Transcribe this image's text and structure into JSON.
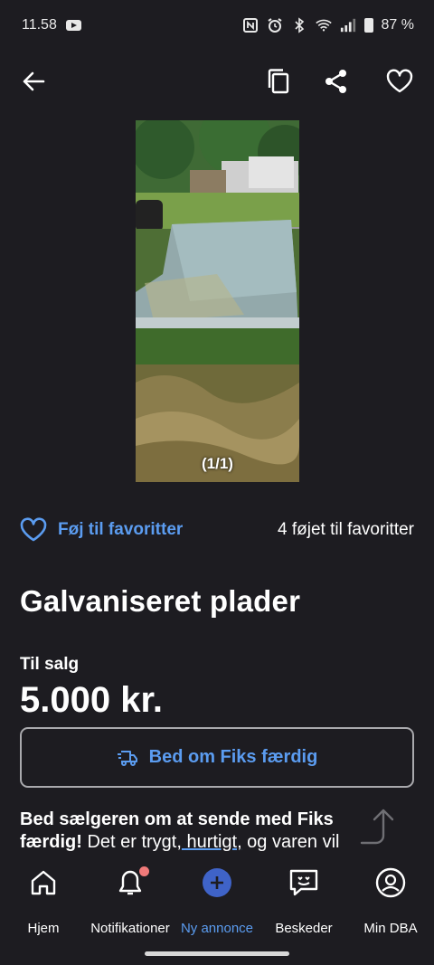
{
  "status_bar": {
    "time": "11.58",
    "battery": "87 %"
  },
  "photo": {
    "counter": "(1/1)"
  },
  "favorites": {
    "action_label": "Føj til favoritter",
    "count_text": "4 føjet til favoritter"
  },
  "listing": {
    "title": "Galvaniseret plader",
    "sale_type": "Til salg",
    "price": "5.000 kr."
  },
  "fiks": {
    "button_label": "Bed om Fiks færdig",
    "desc_bold": "Bed sælgeren om at sende med Fiks færdig!",
    "desc_rest_1": " Det er trygt,",
    "desc_link": " hurtigt,",
    "desc_rest_2": " og varen vil"
  },
  "nav": {
    "items": [
      {
        "label": "Hjem",
        "icon": "home-icon"
      },
      {
        "label": "Notifikationer",
        "icon": "bell-icon"
      },
      {
        "label": "Ny annonce",
        "icon": "add-icon"
      },
      {
        "label": "Beskeder",
        "icon": "message-icon"
      },
      {
        "label": "Min DBA",
        "icon": "profile-icon"
      }
    ]
  },
  "colors": {
    "background": "#1d1c21",
    "accent": "#5b9cf0",
    "badge": "#f07a7a"
  }
}
